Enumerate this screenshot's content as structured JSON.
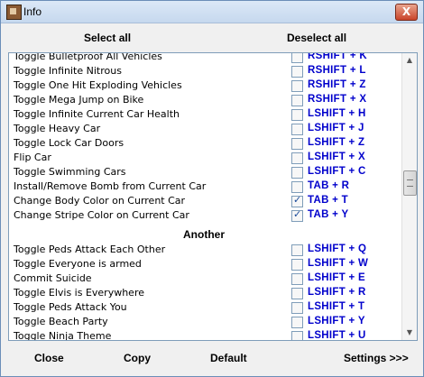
{
  "window": {
    "title": "Info",
    "close_glyph": "X",
    "icon": "app-icon"
  },
  "top": {
    "select_all": "Select all",
    "deselect_all": "Deselect all"
  },
  "list": [
    {
      "label": "Toggle Bulletproof All Vehicles",
      "checked": false,
      "key": "RSHIFT + K"
    },
    {
      "label": "Toggle Infinite Nitrous",
      "checked": false,
      "key": "RSHIFT + L"
    },
    {
      "label": "Toggle One Hit Exploding Vehicles",
      "checked": false,
      "key": "RSHIFT + Z"
    },
    {
      "label": "Toggle Mega Jump on Bike",
      "checked": false,
      "key": "RSHIFT + X"
    },
    {
      "label": "Toggle Infinite Current Car Health",
      "checked": false,
      "key": "LSHIFT + H"
    },
    {
      "label": "Toggle Heavy Car",
      "checked": false,
      "key": "LSHIFT + J"
    },
    {
      "label": "Toggle Lock Car Doors",
      "checked": false,
      "key": "LSHIFT + Z"
    },
    {
      "label": "Flip Car",
      "checked": false,
      "key": "LSHIFT + X"
    },
    {
      "label": "Toggle Swimming Cars",
      "checked": false,
      "key": "LSHIFT + C"
    },
    {
      "label": "Install/Remove Bomb from Current Car",
      "checked": false,
      "key": "TAB + R"
    },
    {
      "label": "Change Body Color on Current Car",
      "checked": true,
      "key": "TAB + T"
    },
    {
      "label": "Change Stripe Color on Current Car",
      "checked": true,
      "key": "TAB + Y"
    }
  ],
  "section_header": "Another",
  "list2": [
    {
      "label": "Toggle Peds Attack Each Other",
      "checked": false,
      "key": "LSHIFT + Q"
    },
    {
      "label": "Toggle Everyone is armed",
      "checked": false,
      "key": "LSHIFT + W"
    },
    {
      "label": "Commit Suicide",
      "checked": false,
      "key": "LSHIFT + E"
    },
    {
      "label": "Toggle Elvis is Everywhere",
      "checked": false,
      "key": "LSHIFT + R"
    },
    {
      "label": "Toggle Peds Attack You",
      "checked": false,
      "key": "LSHIFT + T"
    },
    {
      "label": "Toggle Beach Party",
      "checked": false,
      "key": "LSHIFT + Y"
    },
    {
      "label": "Toggle Ninja Theme",
      "checked": false,
      "key": "LSHIFT + U"
    }
  ],
  "scrollbar": {
    "up_glyph": "▲",
    "down_glyph": "▼"
  },
  "bottom": {
    "close": "Close",
    "copy": "Copy",
    "default": "Default",
    "settings": "Settings >>>"
  }
}
